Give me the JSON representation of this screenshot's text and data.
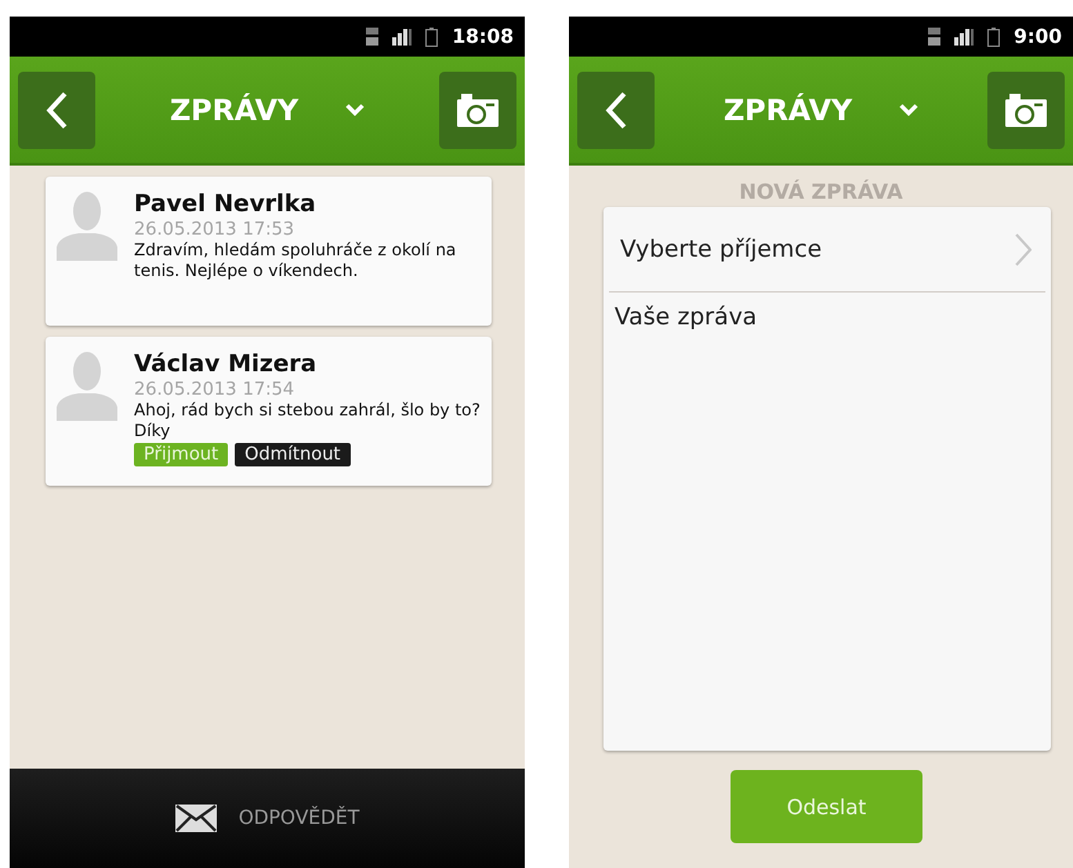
{
  "screens": [
    {
      "kind": "inbox",
      "status_bar": {
        "time": "18:08"
      },
      "header": {
        "title": "ZPRÁVY"
      },
      "messages": [
        {
          "name": "Pavel Nevrlka",
          "date": "26.05.2013 17:53",
          "text": "Zdravím, hledám spoluhráče z okolí na tenis. Nejlépe o víkendech."
        },
        {
          "name": "Václav Mizera",
          "date": "26.05.2013 17:54",
          "text": "Ahoj, rád bych si stebou zahrál, šlo by to? Díky",
          "actions": [
            {
              "label": "Přijmout",
              "kind": "accept"
            },
            {
              "label": "Odmítnout",
              "kind": "decline"
            }
          ]
        }
      ],
      "bottom_bar": {
        "label": "ODPOVĚDĚT"
      }
    },
    {
      "kind": "compose",
      "status_bar": {
        "time": "9:00"
      },
      "header": {
        "title": "ZPRÁVY"
      },
      "form_title": "NOVÁ ZPRÁVA",
      "recipient": {
        "placeholder": "Vyberte příjemce"
      },
      "message": {
        "placeholder": "Vaše zpráva"
      },
      "send_button": "Odeslat"
    }
  ]
}
